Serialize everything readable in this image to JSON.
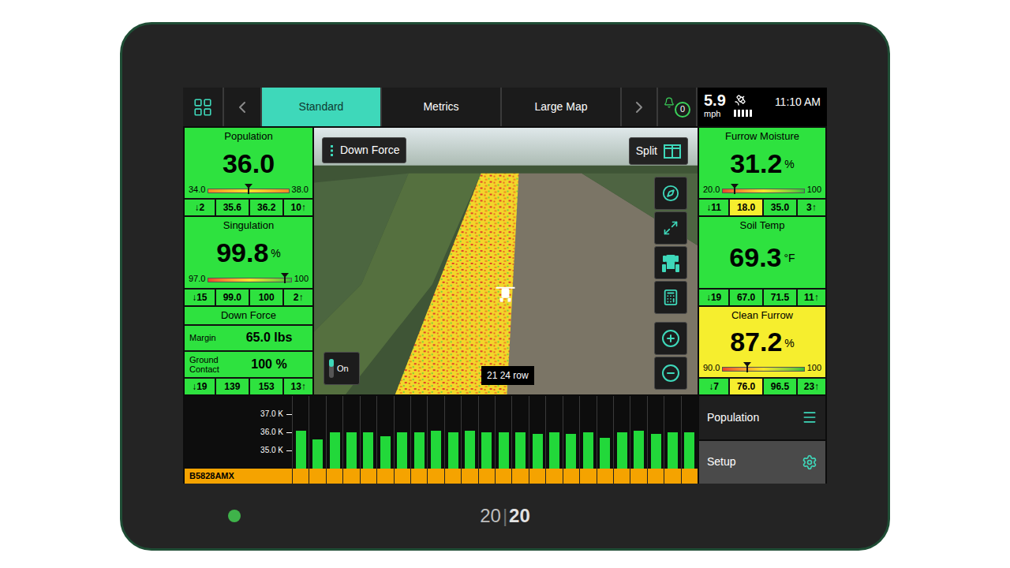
{
  "device": {
    "logo": {
      "left": "20",
      "separator": "|",
      "right": "20"
    },
    "power_on": true
  },
  "top_bar": {
    "tabs": [
      {
        "label": "Standard",
        "selected": true
      },
      {
        "label": "Metrics",
        "selected": false
      },
      {
        "label": "Large Map",
        "selected": false
      }
    ],
    "notifications": "0",
    "speed": "5.9",
    "speed_unit": "mph",
    "gps_signal_level": 1,
    "time": "11:10 AM"
  },
  "left_cards": [
    {
      "kind": "gauge",
      "title": "Population",
      "value": "36.0",
      "color": "#2ee23f",
      "gauge": {
        "min": "34.0",
        "max": "38.0",
        "level": 0.5,
        "scale": "centered"
      },
      "stats": [
        {
          "text": "↓2",
          "color": "#2ee23f"
        },
        {
          "text": "35.6",
          "color": "#2ee23f"
        },
        {
          "text": "36.2",
          "color": "#2ee23f"
        },
        {
          "text": "10↑",
          "color": "#2ee23f"
        }
      ]
    },
    {
      "kind": "gauge",
      "title": "Singulation",
      "value": "99.8",
      "unit": "%",
      "color": "#2ee23f",
      "gauge": {
        "min": "97.0",
        "max": "100",
        "level": 0.93,
        "scale": "rising"
      },
      "stats": [
        {
          "text": "↓15",
          "color": "#2ee23f"
        },
        {
          "text": "99.0",
          "color": "#2ee23f"
        },
        {
          "text": "100",
          "color": "#2ee23f"
        },
        {
          "text": "2↑",
          "color": "#2ee23f"
        }
      ]
    },
    {
      "kind": "rows",
      "title": "Down Force",
      "color": "#2ee23f",
      "rows": [
        {
          "label": "Margin",
          "value": "65.0 lbs"
        },
        {
          "label": "Ground Contact",
          "value": "100 %"
        }
      ],
      "stats": [
        {
          "text": "↓19",
          "color": "#2ee23f"
        },
        {
          "text": "139",
          "color": "#2ee23f"
        },
        {
          "text": "153",
          "color": "#2ee23f"
        },
        {
          "text": "13↑",
          "color": "#2ee23f"
        }
      ]
    }
  ],
  "right_cards": [
    {
      "kind": "gauge",
      "title": "Furrow Moisture",
      "value": "31.2",
      "unit": "%",
      "color": "#2ee23f",
      "gauge": {
        "min": "20.0",
        "max": "100",
        "level": 0.14,
        "scale": "rising"
      },
      "stats": [
        {
          "text": "↓11",
          "color": "#2ee23f"
        },
        {
          "text": "18.0",
          "color": "#f6ee2e"
        },
        {
          "text": "35.0",
          "color": "#2ee23f"
        },
        {
          "text": "3↑",
          "color": "#2ee23f"
        }
      ]
    },
    {
      "kind": "value",
      "title": "Soil Temp",
      "value": "69.3",
      "unit": "°F",
      "color": "#2ee23f",
      "stats": [
        {
          "text": "↓19",
          "color": "#2ee23f"
        },
        {
          "text": "67.0",
          "color": "#2ee23f"
        },
        {
          "text": "71.5",
          "color": "#2ee23f"
        },
        {
          "text": "11↑",
          "color": "#2ee23f"
        }
      ]
    },
    {
      "kind": "gauge",
      "title": "Clean Furrow",
      "value": "87.2",
      "unit": "%",
      "color": "#f6ee2e",
      "gauge": {
        "min": "90.0",
        "max": "100",
        "level": 0.3,
        "scale": "rising"
      },
      "stats": [
        {
          "text": "↓7",
          "color": "#2ee23f"
        },
        {
          "text": "76.0",
          "color": "#f6ee2e"
        },
        {
          "text": "96.5",
          "color": "#2ee23f"
        },
        {
          "text": "23↑",
          "color": "#2ee23f"
        }
      ]
    }
  ],
  "map": {
    "layer_button": "Down Force",
    "split_button": "Split",
    "toggle": {
      "label": "On",
      "on": true
    },
    "row_label": "21 24 row"
  },
  "chart": {
    "ticks": [
      "37.0 K",
      "36.0 K",
      "35.0 K"
    ],
    "label": "B5828AMX",
    "values": [
      36.1,
      35.6,
      36.0,
      36.0,
      36.0,
      35.8,
      36.0,
      36.0,
      36.1,
      36.0,
      36.1,
      36.0,
      36.0,
      36.0,
      35.9,
      36.0,
      35.9,
      36.0,
      35.7,
      36.0,
      36.1,
      35.9,
      36.0,
      36.0
    ]
  },
  "side_buttons": [
    {
      "label": "Population",
      "kind": "menu"
    },
    {
      "label": "Setup",
      "kind": "settings"
    }
  ]
}
